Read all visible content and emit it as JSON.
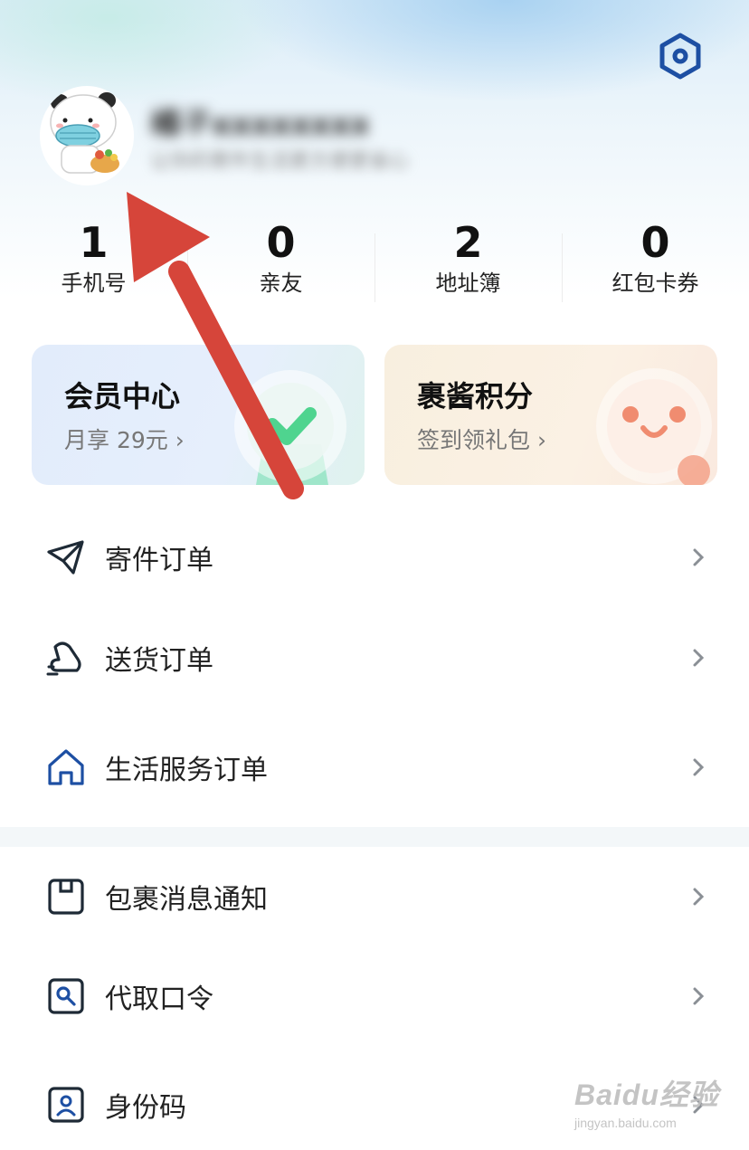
{
  "header": {
    "user_name": "橘子xxxxxxxx",
    "user_subtitle": "让你的寄件生活更方便更省心"
  },
  "stats": [
    {
      "value": "1",
      "label": "手机号"
    },
    {
      "value": "0",
      "label": "亲友"
    },
    {
      "value": "2",
      "label": "地址簿"
    },
    {
      "value": "0",
      "label": "红包卡券"
    }
  ],
  "cards": {
    "member": {
      "title": "会员中心",
      "subtitle": "月享 29元 ›"
    },
    "points": {
      "title": "裹酱积分",
      "subtitle": "签到领礼包 ›"
    }
  },
  "menu": [
    {
      "label": "寄件订单",
      "icon": "paper-plane-icon"
    },
    {
      "label": "送货订单",
      "icon": "delivery-icon"
    },
    {
      "label": "生活服务订单",
      "icon": "home-icon"
    },
    {
      "label": "包裹消息通知",
      "icon": "package-icon"
    },
    {
      "label": "代取口令",
      "icon": "key-search-icon"
    },
    {
      "label": "身份码",
      "icon": "id-code-icon"
    }
  ],
  "watermark": {
    "brand": "Baidu经验",
    "url": "jingyan.baidu.com"
  },
  "colors": {
    "accent": "#1d4fa3",
    "icon_dark": "#1e2a36",
    "annotation_arrow": "#d6453a"
  }
}
